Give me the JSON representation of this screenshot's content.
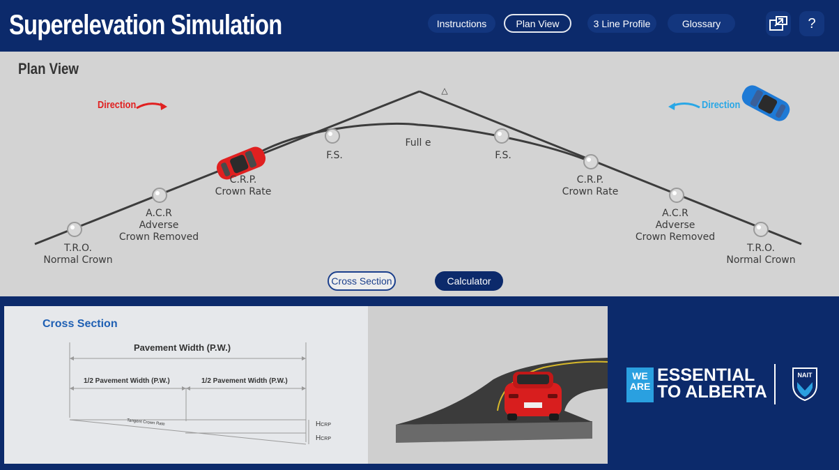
{
  "app": {
    "title": "Superelevation Simulation"
  },
  "nav": {
    "instructions": "Instructions",
    "plan_view": "Plan View",
    "three_line_profile": "3 Line Profile",
    "glossary": "Glossary",
    "help": "?",
    "icons": {
      "popout": "external-window-icon",
      "help": "question-icon"
    }
  },
  "plan_view": {
    "title": "Plan View",
    "direction_left": "Direction",
    "direction_right": "Direction",
    "delta_symbol": "△",
    "center_label": "Full e",
    "points": {
      "tro_left": [
        "T.R.O.",
        "Normal Crown"
      ],
      "acr_left": [
        "A.C.R",
        "Adverse",
        "Crown Removed"
      ],
      "crp_left": [
        "C.R.P.",
        "Crown Rate"
      ],
      "fs_left": [
        "F.S."
      ],
      "fs_right": [
        "F.S."
      ],
      "crp_right": [
        "C.R.P.",
        "Crown Rate"
      ],
      "acr_right": [
        "A.C.R",
        "Adverse",
        "Crown Removed"
      ],
      "tro_right": [
        "T.R.O.",
        "Normal Crown"
      ]
    },
    "buttons": {
      "cross_section": "Cross Section",
      "calculator": "Calculator"
    }
  },
  "cross_section": {
    "title": "Cross Section",
    "pavement_width": "Pavement Width (P.W.)",
    "half_left": "1/2 Pavement Width (P.W.)",
    "half_right": "1/2 Pavement Width (P.W.)",
    "tangent_label": "Tangent Crown Rate",
    "h_crp_1_main": "H",
    "h_crp_1_sub": "CRP",
    "h_crp_2_main": "H",
    "h_crp_2_sub": "CRP"
  },
  "branding": {
    "we": "WE",
    "are": "ARE",
    "line1": "ESSENTIAL",
    "line2": "TO ALBERTA",
    "nait": "NAIT"
  },
  "colors": {
    "navy": "#0c2a6b",
    "panel_gray": "#d3d3d3",
    "red_car": "#e02020",
    "blue_car": "#1e7ad6",
    "direction_blue": "#29a7e6",
    "accent_blue": "#2aa0e0"
  }
}
